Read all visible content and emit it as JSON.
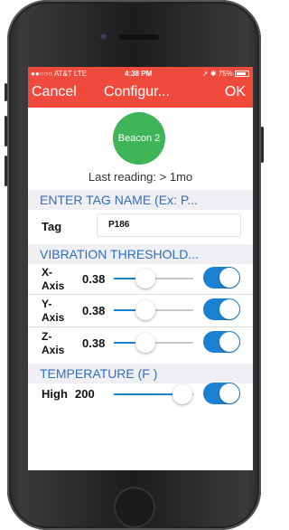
{
  "status_bar": {
    "carrier": "●●○○○ AT&T  LTE",
    "time": "4:38 PM",
    "right": "➚ ✱ 75%"
  },
  "nav": {
    "cancel_label": "Cancel",
    "title": "Configur...",
    "ok_label": "OK"
  },
  "beacon": {
    "name": "Beacon 2",
    "last_reading": "Last reading: > 1mo",
    "avatar_color": "#3fb558"
  },
  "sections": {
    "tag_header": "ENTER TAG NAME (Ex: P...",
    "vibration_header": "VIBRATION THRESHOLD...",
    "temperature_header": "TEMPERATURE (F )"
  },
  "tag": {
    "label": "Tag",
    "value": "P186"
  },
  "vibration": [
    {
      "axis_label": "X-\nAxis",
      "value": "0.38",
      "slider_fraction": 0.38,
      "enabled": true
    },
    {
      "axis_label": "Y-\nAxis",
      "value": "0.38",
      "slider_fraction": 0.38,
      "enabled": true
    },
    {
      "axis_label": "Z-\nAxis",
      "value": "0.38",
      "slider_fraction": 0.38,
      "enabled": true
    }
  ],
  "temperature": {
    "label": "High",
    "value": "200",
    "slider_fraction": 0.86,
    "enabled": true
  },
  "colors": {
    "nav_bar": "#f04a3c",
    "accent": "#1a82d1",
    "section_text": "#2f6fbf"
  }
}
